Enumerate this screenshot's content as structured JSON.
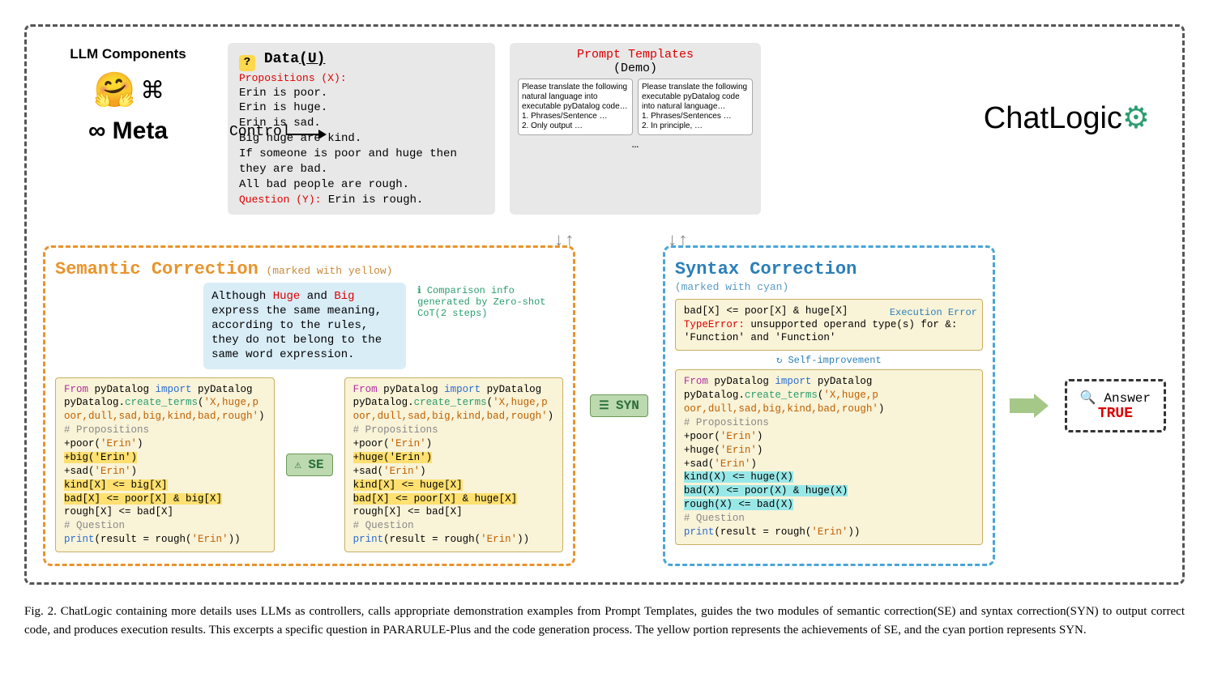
{
  "llm": {
    "title": "LLM Components",
    "meta": "∞ Meta",
    "control": "Control"
  },
  "data": {
    "title_prefix": "Data",
    "title_suffix": "(U)",
    "propositions_label": "Propositions (X):",
    "propositions": "Erin is poor.\nErin is huge.\nErin is sad.\nBig huge are kind.\nIf someone is poor and huge then they are bad.\nAll bad people are rough.",
    "question_label": "Question (Y):",
    "question_text": "Erin is rough."
  },
  "prompts": {
    "title": "Prompt Templates",
    "demo": "(Demo)",
    "left": "Please translate the following natural language into executable pyDatalog code…\n1. Phrases/Sentence …\n2. Only output …",
    "right": "Please translate the following executable pyDatalog code into natural language…\n1. Phrases/Sentences …\n2. In principle, …",
    "dots": "…"
  },
  "chatlogic": "ChatLogic",
  "semantic": {
    "title": "Semantic Correction",
    "marked": "(marked with yellow)",
    "note_pre": "Although ",
    "note_h1": "Huge",
    "note_mid1": " and ",
    "note_h2": "Big",
    "note_post": " express the same meaning, according to the rules, they do not belong to the same word expression.",
    "comparison": "Comparison info generated by Zero-shot CoT(2 steps)",
    "se": "SE"
  },
  "syntax": {
    "title": "Syntax Correction",
    "marked": "(marked with cyan)",
    "error_line1": "bad[X] <= poor[X] & huge[X]",
    "error_label": "TypeError:",
    "error_msg": " unsupported operand type(s) for &: 'Function' and 'Function'",
    "exec": "Execution Error",
    "selfimp": "Self-improvement",
    "syn": "SYN"
  },
  "code": {
    "l1": "From pyDatalog import pyDatalog",
    "l2a": "pyDatalog.",
    "l2b": "create_terms",
    "l2c": "('X,huge,p\noor,dull,sad,big,kind,bad,rough')",
    "props": "# Propositions",
    "poor": "+poor('Erin')",
    "big": "+big('Erin')",
    "huge": "+huge('Erin')",
    "sad": "+sad('Erin')",
    "kind_big": "kind[X] <= big[X]",
    "kind_huge": "kind[X] <= huge[X]",
    "bad_big": "bad[X] <= poor[X] & big[X]",
    "bad_huge": "bad[X] <= poor[X] & huge[X]",
    "rough": "rough[X] <= bad[X]",
    "kind_hugeP": "kind(X) <= huge(X)",
    "bad_hugeP": "bad(X) <= poor(X) & huge(X)",
    "roughP": "rough(X) <= bad(X)",
    "ques": "# Question",
    "print": "print(result = rough('Erin'))"
  },
  "answer": {
    "title": "Answer",
    "value": "TRUE"
  },
  "caption": "Fig. 2.   ChatLogic containing more details uses LLMs as controllers, calls appropriate demonstration examples from Prompt Templates, guides the two modules of semantic correction(SE) and syntax correction(SYN) to output correct code, and produces execution results. This excerpts a specific question in PARARULE-Plus and the code generation process. The yellow portion represents the achievements of SE, and the cyan portion represents SYN."
}
